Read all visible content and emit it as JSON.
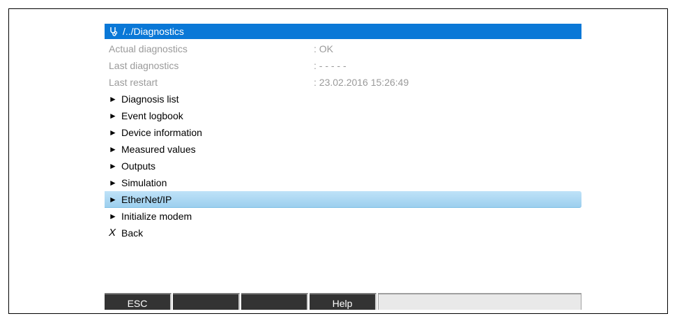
{
  "title": {
    "icon": "stethoscope-icon",
    "path": "/../Diagnostics"
  },
  "info_rows": [
    {
      "label": "Actual diagnostics",
      "value": ": OK"
    },
    {
      "label": "Last diagnostics",
      "value": ": - - - - -"
    },
    {
      "label": "Last restart",
      "value": ": 23.02.2016 15:26:49"
    }
  ],
  "menu": {
    "items": [
      {
        "label": "Diagnosis list"
      },
      {
        "label": "Event logbook"
      },
      {
        "label": "Device information"
      },
      {
        "label": "Measured values"
      },
      {
        "label": "Outputs"
      },
      {
        "label": "Simulation"
      },
      {
        "label": "EtherNet/IP"
      },
      {
        "label": "Initialize modem"
      }
    ],
    "selected": "EtherNet/IP",
    "marker": "►",
    "back_marker": "X",
    "back_label": "Back"
  },
  "softkeys": {
    "key1": "ESC",
    "key2": "",
    "key3": "",
    "key4": "Help",
    "key5": ""
  },
  "colors": {
    "title_bar": "#0a78d7",
    "selection": "#b4dcf4",
    "info_text": "#9a9a9a",
    "softkey": "#333333"
  }
}
